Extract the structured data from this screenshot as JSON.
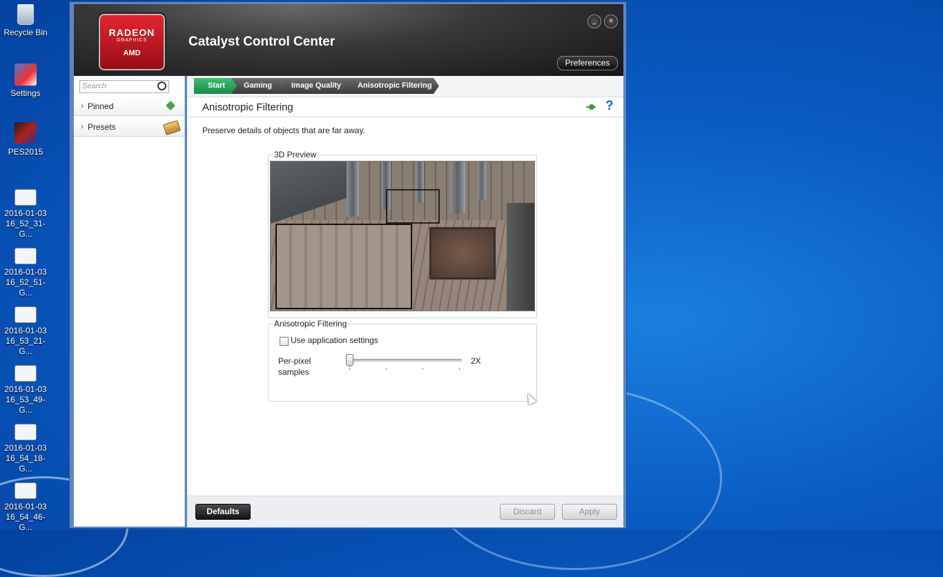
{
  "desktop": {
    "icons": [
      {
        "label": "Recycle Bin",
        "icon": "recycle-bin-icon"
      },
      {
        "label": "Settings",
        "icon": "settings-shortcut-icon"
      },
      {
        "label": "PES2015",
        "icon": "pes2015-icon"
      },
      {
        "label": "2016-01-03 16_52_31-G...",
        "icon": "image-file-icon"
      },
      {
        "label": "2016-01-03 16_52_51-G...",
        "icon": "image-file-icon"
      },
      {
        "label": "2016-01-03 16_53_21-G...",
        "icon": "image-file-icon"
      },
      {
        "label": "2016-01-03 16_53_49-G...",
        "icon": "image-file-icon"
      },
      {
        "label": "2016-01-03 16_54_18-G...",
        "icon": "image-file-icon"
      },
      {
        "label": "2016-01-03 16_54_46-G...",
        "icon": "image-file-icon"
      }
    ]
  },
  "window": {
    "title": "Catalyst Control Center",
    "logo": {
      "line1": "RADEON",
      "line2": "GRAPHICS",
      "line3": "AMD"
    },
    "minimize_label": "_",
    "close_label": "×",
    "preferences_label": "Preferences"
  },
  "sidebar": {
    "search_placeholder": "Search",
    "items": [
      {
        "label": "Pinned",
        "icon": "pin-icon"
      },
      {
        "label": "Presets",
        "icon": "presets-icon"
      }
    ]
  },
  "breadcrumbs": [
    "Start",
    "Gaming",
    "Image Quality",
    "Anisotropic Filtering"
  ],
  "page": {
    "title": "Anisotropic Filtering",
    "description": "Preserve details of objects that are far away.",
    "preview_label": "3D Preview",
    "af_group_label": "Anisotropic Filtering",
    "use_app_settings_label": "Use application settings",
    "use_app_settings_checked": false,
    "per_pixel_label": "Per-pixel samples",
    "slider_value": "2X",
    "slider_level": 0
  },
  "footer": {
    "defaults_label": "Defaults",
    "discard_label": "Discard",
    "apply_label": "Apply"
  },
  "colors": {
    "accent_green": "#178a48",
    "amd_red": "#e12630",
    "help_blue": "#1d64c4"
  }
}
